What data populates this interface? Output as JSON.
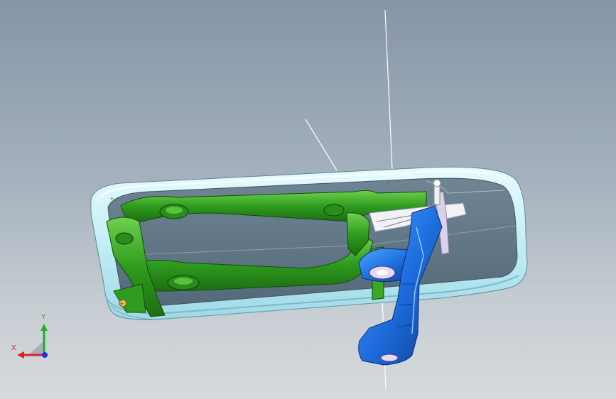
{
  "viewport": {
    "background_top": "#8695a8",
    "background_bottom": "#d6dadc"
  },
  "model": {
    "housing_color": "#c9f0f6",
    "frame_color": "#2e9a1f",
    "bracket_color": "#1f6fe0",
    "lever_color": "#e8e8ee"
  },
  "triad": {
    "x_label": "X",
    "y_label": "Y",
    "x_color": "#e02020",
    "y_color": "#20b020",
    "z_color": "#2030e0"
  }
}
